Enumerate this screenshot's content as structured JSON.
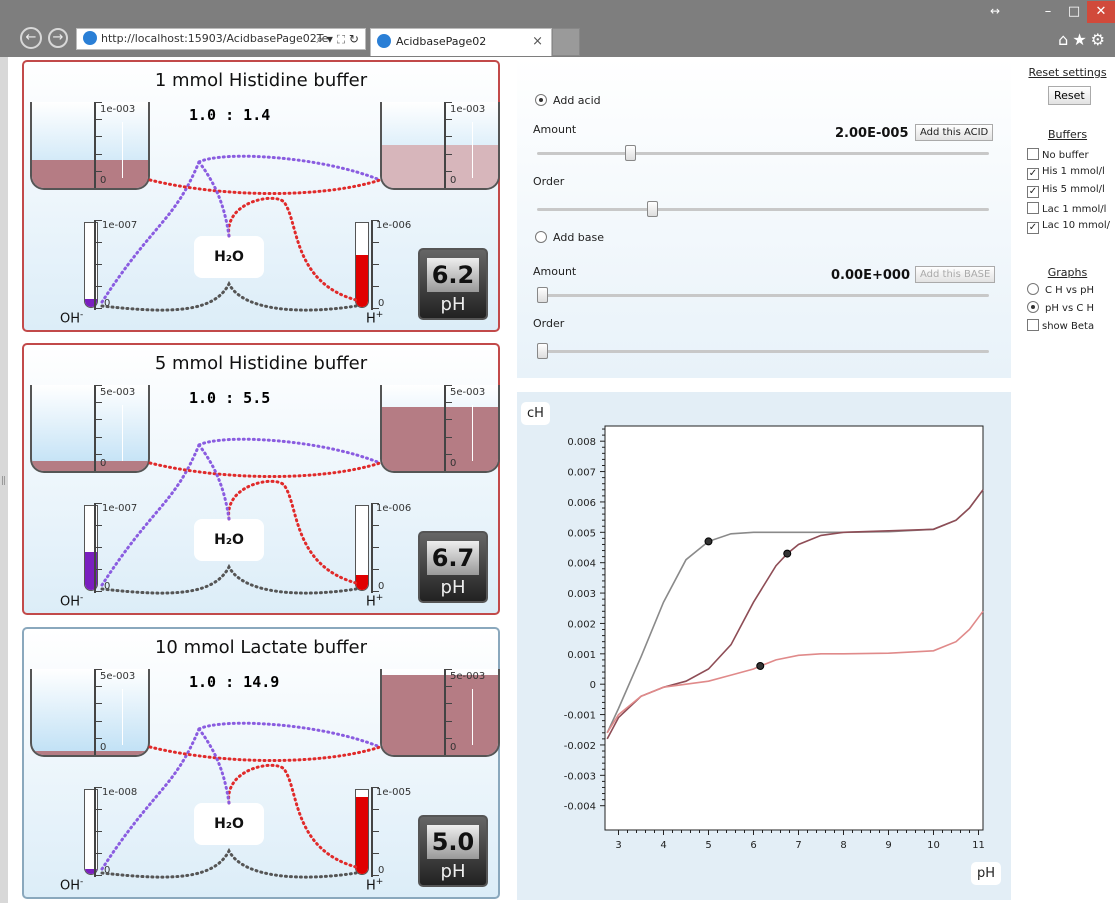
{
  "browser": {
    "url": "http://localhost:15903/AcidbasePage02Te",
    "url_tools": "⌕ ▾ ⛶ ↻",
    "tab_title": "AcidbasePage02",
    "tab_close": "×"
  },
  "panels": [
    {
      "title": "1 mmol Histidine buffer",
      "ratio": "1.0 : 1.4",
      "left_scale": "1e-003",
      "right_scale": "1e-003",
      "left_zero": "0",
      "right_zero": "0",
      "oh_scale": "1e-007",
      "h_scale": "1e-006",
      "tube_zero": "0",
      "ph": "6.2",
      "left_fill": 0.33,
      "right_fill": 0.5,
      "right_light": true,
      "oh_fill": 0.1,
      "h_fill": 0.62,
      "h_color": "#e00000",
      "oh_color": "#7a1fbf"
    },
    {
      "title": "5 mmol Histidine buffer",
      "ratio": "1.0 : 5.5",
      "left_scale": "5e-003",
      "right_scale": "5e-003",
      "left_zero": "0",
      "right_zero": "0",
      "oh_scale": "1e-007",
      "h_scale": "1e-006",
      "tube_zero": "0",
      "ph": "6.7",
      "left_fill": 0.12,
      "right_fill": 0.75,
      "right_light": false,
      "oh_fill": 0.45,
      "h_fill": 0.18,
      "h_color": "#e00000",
      "oh_color": "#7a1fbf"
    },
    {
      "title": "10 mmol Lactate buffer",
      "ratio": "1.0 : 14.9",
      "left_scale": "5e-003",
      "right_scale": "5e-003",
      "left_zero": "0",
      "right_zero": "0",
      "oh_scale": "1e-008",
      "h_scale": "1e-005",
      "tube_zero": "0",
      "ph": "5.0",
      "left_fill": 0.05,
      "right_fill": 0.93,
      "right_light": false,
      "oh_fill": 0.06,
      "h_fill": 0.92,
      "h_color": "#e00000",
      "oh_color": "#7a1fbf"
    }
  ],
  "labels": {
    "h2o": "H₂O",
    "oh": "OH",
    "h": "H",
    "minus": "-",
    "plus": "+",
    "ph_unit": "pH"
  },
  "controls": {
    "add_acid": "Add acid",
    "add_base": "Add base",
    "amount_label": "Amount",
    "order_label": "Order",
    "acid_amount": "2.00E-005",
    "base_amount": "0.00E+000",
    "add_acid_btn": "Add this ACID",
    "add_base_btn": "Add this BASE",
    "acid_selected": true,
    "acid_amount_pos": 0.2,
    "acid_order_pos": 0.25,
    "base_amount_pos": 0.0,
    "base_order_pos": 0.0
  },
  "side": {
    "reset_heading": "Reset settings",
    "reset_btn": "Reset",
    "buffers_heading": "Buffers",
    "buffers": [
      {
        "label": "No buffer",
        "checked": false
      },
      {
        "label": "His 1 mmol/l",
        "checked": true
      },
      {
        "label": "His 5 mmol/l",
        "checked": true
      },
      {
        "label": "Lac 1 mmol/l",
        "checked": false
      },
      {
        "label": "Lac 10 mmol/",
        "checked": true
      }
    ],
    "graphs_heading": "Graphs",
    "graphs": [
      {
        "label": "C H  vs pH",
        "selected": false
      },
      {
        "label": "pH vs C H",
        "selected": true
      }
    ],
    "show_beta": "show Beta",
    "check_mark": "✓"
  },
  "chart_data": {
    "type": "line",
    "xlabel": "pH",
    "ylabel": "cH",
    "xlim": [
      2.7,
      11.1
    ],
    "ylim": [
      -0.0048,
      0.0085
    ],
    "xticks": [
      3,
      4,
      5,
      6,
      7,
      8,
      9,
      10,
      11
    ],
    "yticks": [
      -0.004,
      -0.003,
      -0.002,
      -0.001,
      0,
      0.001,
      0.002,
      0.003,
      0.004,
      0.005,
      0.006,
      0.007,
      0.008
    ],
    "ytick_labels": [
      "-0.004",
      "-0.003",
      "-0.002",
      "-0.001",
      "0",
      "0.001",
      "0.002",
      "0.003",
      "0.004",
      "0.005",
      "0.006",
      "0.007",
      "0.008"
    ],
    "series": [
      {
        "color": "#8a8a8a",
        "x": [
          2.75,
          3.0,
          3.5,
          4.0,
          4.5,
          5.0,
          5.5,
          6.0,
          7.0,
          8.0,
          9.0,
          10.0,
          10.5,
          10.8,
          11.1
        ],
        "y": [
          -0.0016,
          -0.0008,
          0.0009,
          0.0027,
          0.0041,
          0.0047,
          0.00495,
          0.005,
          0.005,
          0.005,
          0.00502,
          0.0051,
          0.0054,
          0.0058,
          0.0064
        ],
        "marker": [
          5.0,
          0.0047
        ]
      },
      {
        "color": "#8e4d56",
        "x": [
          2.75,
          3.0,
          3.5,
          4.0,
          4.5,
          5.0,
          5.5,
          6.0,
          6.5,
          6.75,
          7.0,
          7.5,
          8.0,
          9.0,
          10.0,
          10.5,
          10.8,
          11.1
        ],
        "y": [
          -0.0018,
          -0.0011,
          -0.0004,
          -0.0001,
          0.0001,
          0.0005,
          0.0013,
          0.0027,
          0.0039,
          0.0043,
          0.0046,
          0.0049,
          0.005,
          0.00505,
          0.0051,
          0.0054,
          0.0058,
          0.0064
        ],
        "marker": [
          6.75,
          0.0043
        ]
      },
      {
        "color": "#e08a8a",
        "x": [
          2.75,
          3.0,
          3.5,
          4.0,
          4.5,
          5.0,
          5.5,
          6.0,
          6.15,
          6.5,
          7.0,
          7.5,
          8.0,
          9.0,
          10.0,
          10.5,
          10.8,
          11.1
        ],
        "y": [
          -0.0016,
          -0.001,
          -0.0004,
          -0.0001,
          0.0,
          0.0001,
          0.0003,
          0.0005,
          0.0006,
          0.0008,
          0.00095,
          0.001,
          0.001,
          0.00102,
          0.0011,
          0.0014,
          0.0018,
          0.0024
        ],
        "marker": [
          6.15,
          0.0006
        ]
      }
    ]
  }
}
